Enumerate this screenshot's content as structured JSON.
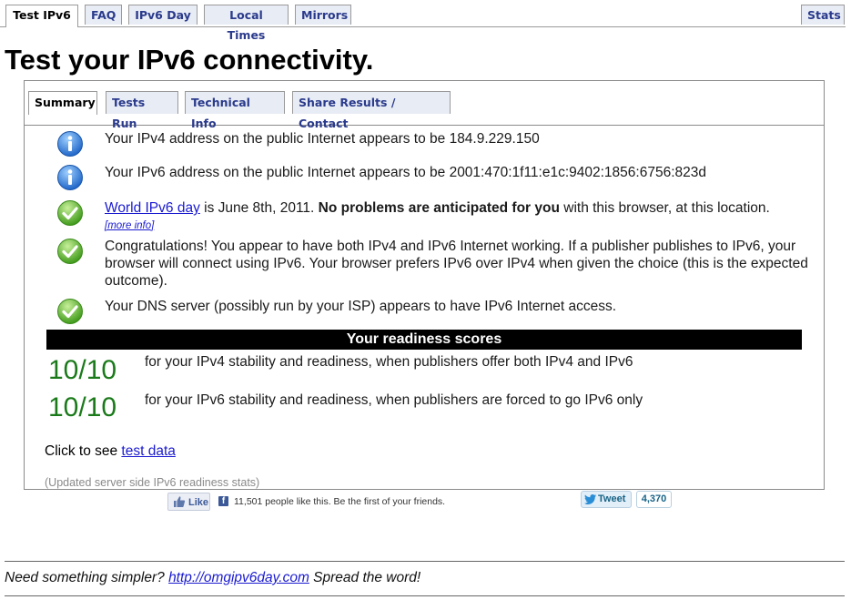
{
  "top_tabs": [
    "Test IPv6",
    "FAQ",
    "IPv6 Day",
    "Local Times",
    "Mirrors"
  ],
  "stats_tab": "Stats",
  "page_title": "Test your IPv6 connectivity.",
  "inner_tabs": [
    "Summary",
    "Tests Run",
    "Technical Info",
    "Share Results / Contact"
  ],
  "messages": {
    "ipv4": "Your IPv4 address on the public Internet appears to be 184.9.229.150",
    "ipv6": "Your IPv6 address on the public Internet appears to be 2001:470:1f11:e1c:9402:1856:6756:823d",
    "day_link": "World IPv6 day",
    "day_mid": " is June 8th, 2011. ",
    "day_bold": "No problems are anticipated for you",
    "day_end": " with this browser, at this location.",
    "more_info": "[more info]",
    "congrats": "Congratulations! You appear to have both IPv4 and IPv6 Internet working. If a publisher publishes to IPv6, your browser will connect using IPv6. Your browser prefers IPv6 over IPv4 when given the choice (this is the expected outcome).",
    "dns": "Your DNS server (possibly run by your ISP) appears to have IPv6 Internet access."
  },
  "icons": [
    "info-icon",
    "info-icon",
    "check-icon",
    "check-icon",
    "check-icon"
  ],
  "readiness": {
    "header": "Your readiness scores",
    "scores": [
      {
        "score": "10/10",
        "text": "for your IPv4 stability and readiness, when publishers offer both IPv4 and IPv6"
      },
      {
        "score": "10/10",
        "text": "for your IPv6 stability and readiness, when publishers are forced to go IPv6 only"
      }
    ]
  },
  "test_data": {
    "prefix": "Click to see ",
    "link": "test data"
  },
  "updated_stats": "(Updated server side IPv6 readiness stats)",
  "social": {
    "like_label": "Like",
    "fb_text": "11,501 people like this. Be the first of your friends.",
    "tweet_label": "Tweet",
    "tweet_count": "4,370"
  },
  "footer": {
    "prefix": "Need something simpler? ",
    "link": "http://omgipv6day.com",
    "suffix": " Spread the word!"
  },
  "colors": {
    "tab_text": "#2a3a8c",
    "tab_bg": "#e8ecf4",
    "score_green": "#1a7a1a",
    "link_blue": "#1a1ad0",
    "info_blue": "#2f7fd6",
    "check_green": "#5cb82a"
  }
}
